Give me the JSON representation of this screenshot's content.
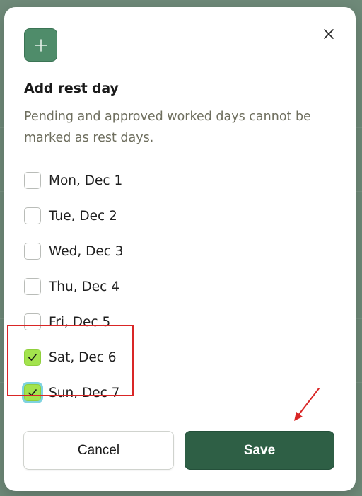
{
  "dialog": {
    "title": "Add rest day",
    "description": "Pending and approved worked days cannot be marked as rest days.",
    "close_icon": "close-icon",
    "header_icon": "plus-icon",
    "accent_color": "#4f8c6a"
  },
  "days": [
    {
      "label": "Mon, Dec 1",
      "checked": false
    },
    {
      "label": "Tue, Dec 2",
      "checked": false
    },
    {
      "label": "Wed, Dec 3",
      "checked": false
    },
    {
      "label": "Thu, Dec 4",
      "checked": false
    },
    {
      "label": "Fri, Dec 5",
      "checked": false
    },
    {
      "label": "Sat, Dec 6",
      "checked": true
    },
    {
      "label": "Sun, Dec 7",
      "checked": true,
      "focused": true
    }
  ],
  "actions": {
    "cancel_label": "Cancel",
    "save_label": "Save",
    "save_color": "#2e5f45"
  },
  "annotation": {
    "highlight_color": "#d92626"
  }
}
